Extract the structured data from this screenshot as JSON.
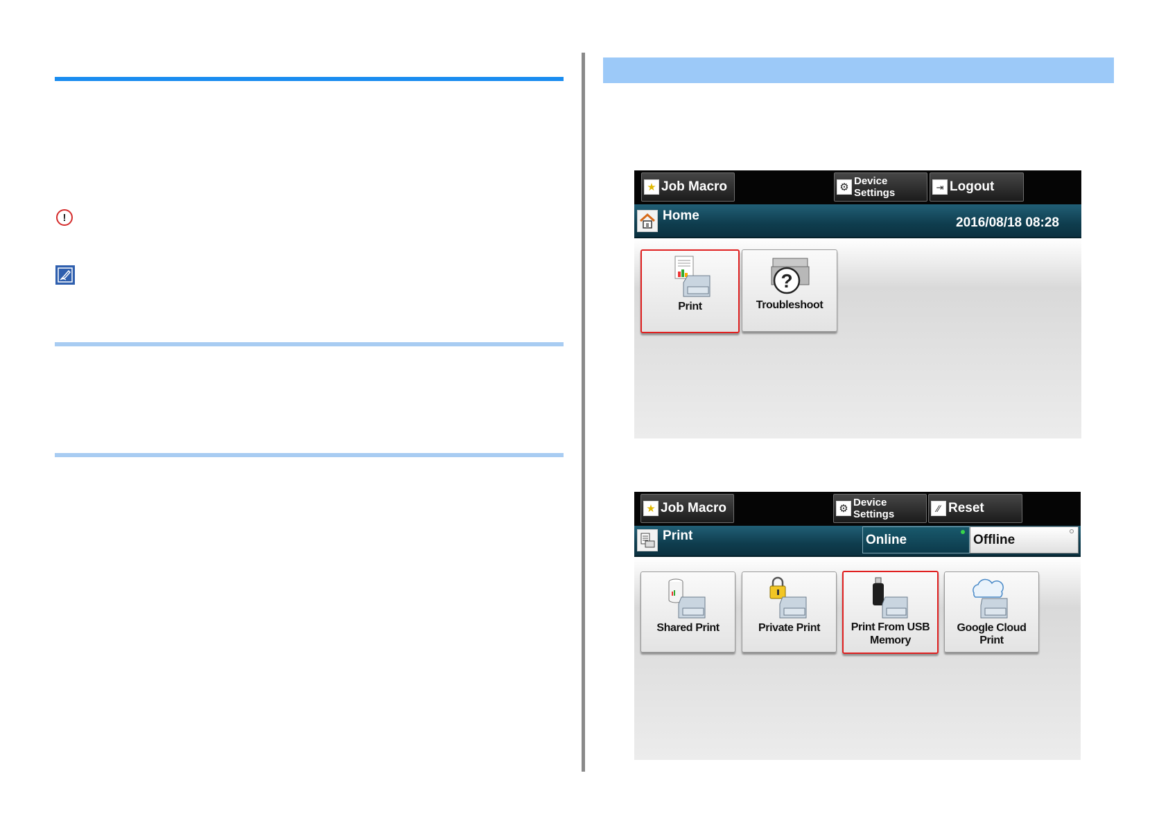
{
  "panel1": {
    "toolbar": {
      "job_macro": "Job Macro",
      "device_settings_1": "Device",
      "device_settings_2": "Settings",
      "logout": "Logout"
    },
    "header": {
      "title": "Home",
      "datetime": "2016/08/18 08:28"
    },
    "tiles": [
      {
        "label": "Print"
      },
      {
        "label": "Troubleshoot"
      }
    ]
  },
  "panel2": {
    "toolbar": {
      "job_macro": "Job Macro",
      "device_settings_1": "Device",
      "device_settings_2": "Settings",
      "reset": "Reset"
    },
    "header": {
      "title": "Print",
      "online": "Online",
      "offline": "Offline"
    },
    "tiles": [
      {
        "label": "Shared Print"
      },
      {
        "label": "Private Print"
      },
      {
        "label_1": "Print From USB",
        "label_2": "Memory"
      },
      {
        "label": "Google Cloud Print"
      }
    ]
  },
  "icons": [
    "caution-icon",
    "memo-icon",
    "star-icon",
    "gear-icon",
    "logout-icon",
    "home-icon",
    "printer-icon",
    "help-icon",
    "reset-icon",
    "database-icon",
    "lock-icon",
    "usb-icon",
    "cloud-icon"
  ],
  "colors": {
    "heading_rule": "#1a8cf0",
    "section_rule": "#a8ccf2",
    "right_bar": "#9cc9f8",
    "selected_border": "#e02020"
  }
}
